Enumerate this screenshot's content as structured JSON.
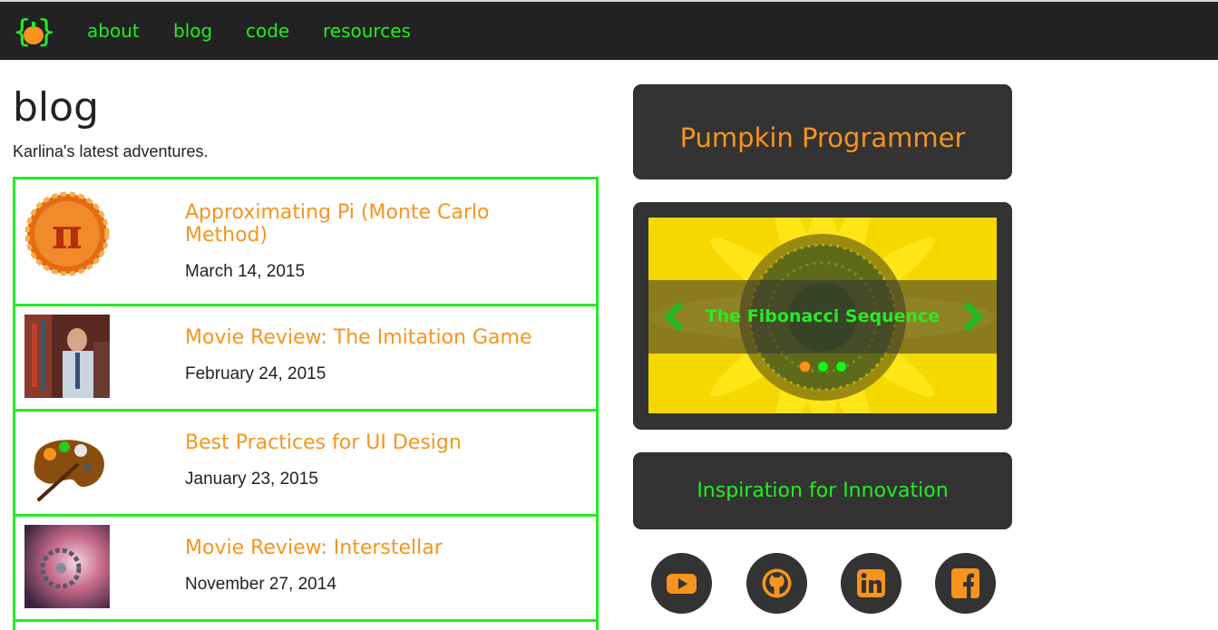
{
  "nav": {
    "logo_icon": "pumpkin-braces-logo",
    "items": [
      {
        "label": "about"
      },
      {
        "label": "blog"
      },
      {
        "label": "code"
      },
      {
        "label": "resources"
      }
    ]
  },
  "main": {
    "title": "blog",
    "subtitle": "Karlina's latest adventures.",
    "posts": [
      {
        "title": "Approximating Pi (Monte Carlo Method)",
        "date": "March 14, 2015",
        "thumb_icon": "pi-pie-thumbnail"
      },
      {
        "title": "Movie Review: The Imitation Game",
        "date": "February 24, 2015",
        "thumb_icon": "imitation-game-thumbnail"
      },
      {
        "title": "Best Practices for UI Design",
        "date": "January 23, 2015",
        "thumb_icon": "paint-palette-thumbnail"
      },
      {
        "title": "Movie Review: Interstellar",
        "date": "November 27, 2014",
        "thumb_icon": "interstellar-thumbnail"
      }
    ]
  },
  "sidebar": {
    "brand_title": "Pumpkin Programmer",
    "slider": {
      "caption": "The Fibonacci Sequence",
      "image_icon": "sunflower-image",
      "active_dot": 0,
      "dot_count": 3
    },
    "inspiration_title": "Inspiration for Innovation",
    "social": [
      {
        "icon": "youtube-icon"
      },
      {
        "icon": "github-icon"
      },
      {
        "icon": "linkedin-icon"
      },
      {
        "icon": "facebook-icon"
      }
    ]
  },
  "colors": {
    "accent_green": "#22ee22",
    "accent_orange": "#f7941d",
    "dark_panel": "#333333",
    "topbar": "#222222"
  }
}
